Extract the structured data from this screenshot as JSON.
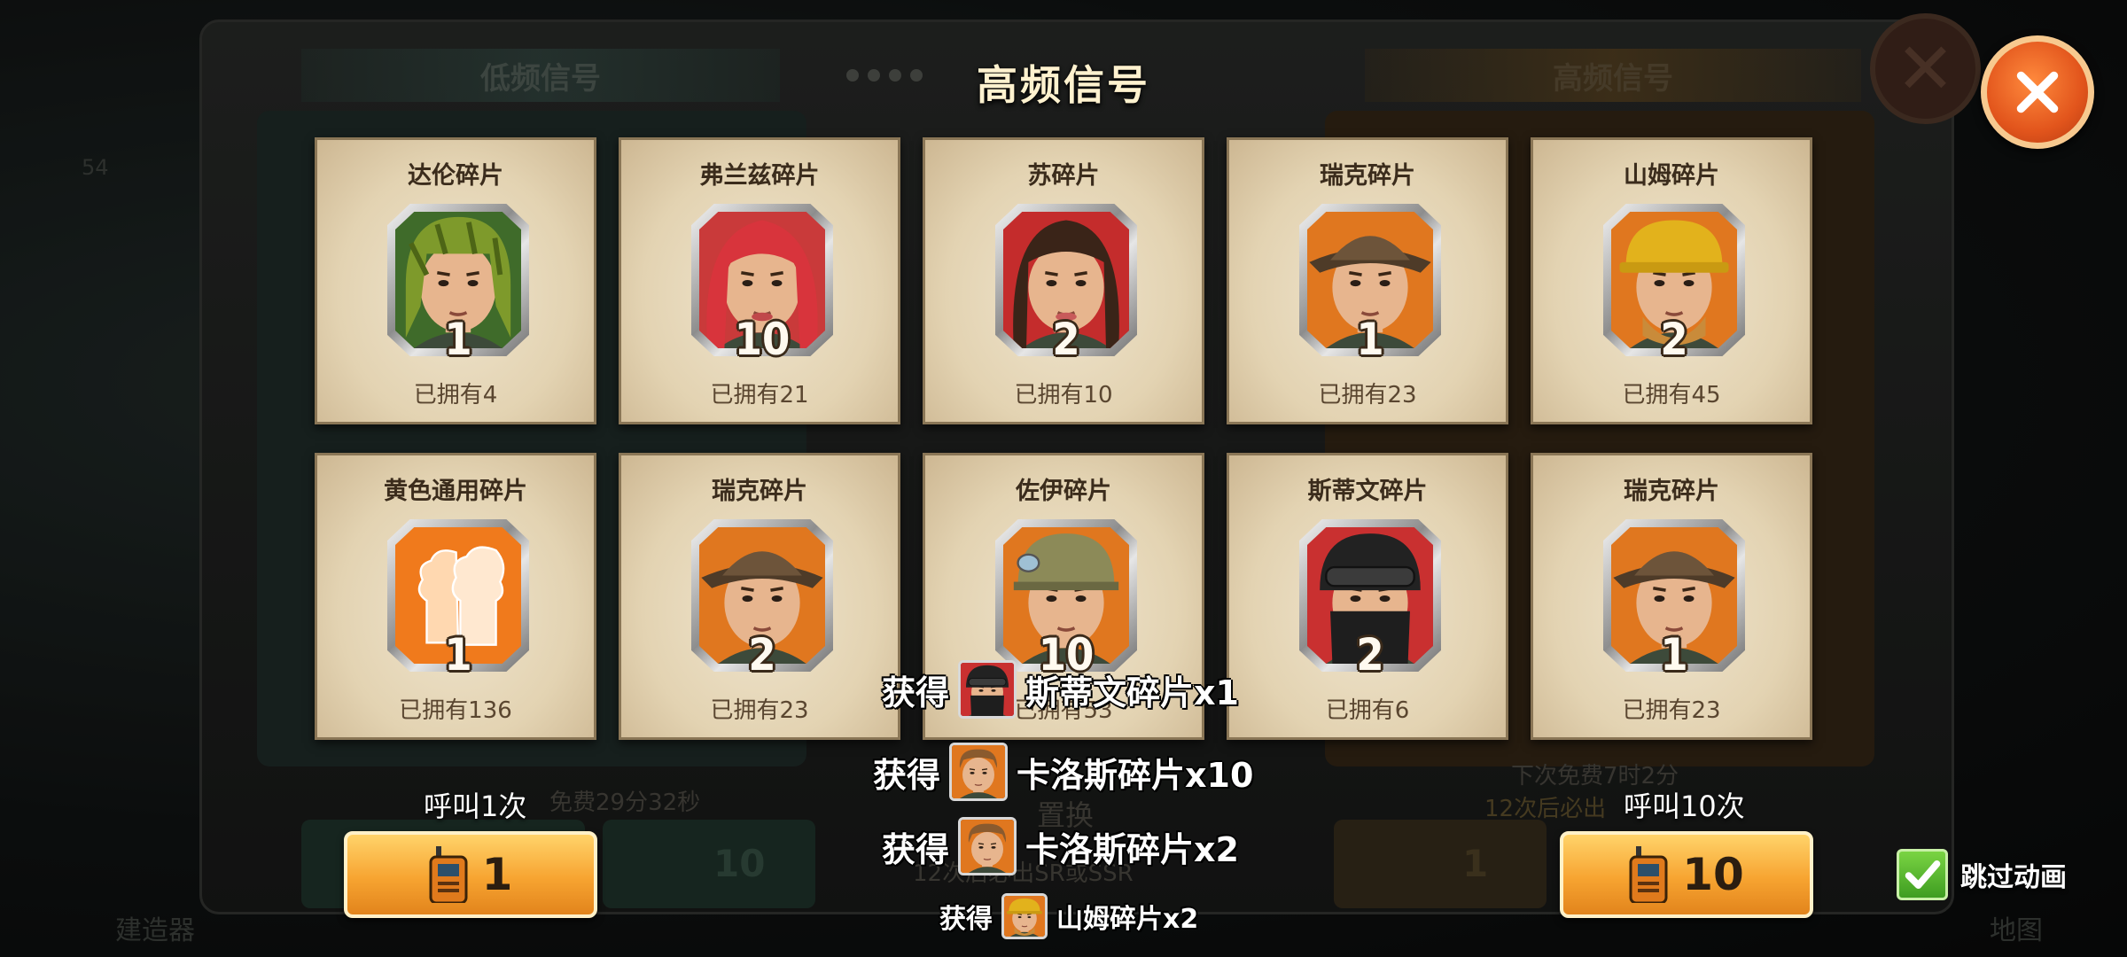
{
  "background": {
    "tab_left": "低频信号",
    "tab_right": "高频信号",
    "left_free_timer": "免费29分32秒",
    "left_bottom_text": "12次后必出SR或SSR",
    "left_btn1_value": "10",
    "right_free_timer": "下次免费7时2分",
    "right_guarantee": "12次后必出",
    "right_btn_left_value": "1",
    "exchange_label": "置换",
    "side_left_label": "建造器",
    "side_right_label": "地图",
    "badge_54": "54"
  },
  "dialog": {
    "title": "高频信号",
    "close_icon": "close-x-icon"
  },
  "cards": [
    {
      "name": "达伦碎片",
      "qty": "1",
      "owned": "已拥有4",
      "portrait": "camo-soldier",
      "bg": "#3f6b2a"
    },
    {
      "name": "弗兰兹碎片",
      "qty": "10",
      "owned": "已拥有21",
      "portrait": "red-hair-girl",
      "bg": "#c93a3a"
    },
    {
      "name": "苏碎片",
      "qty": "2",
      "owned": "已拥有10",
      "portrait": "dark-hair-woman",
      "bg": "#c42c2c"
    },
    {
      "name": "瑞克碎片",
      "qty": "1",
      "owned": "已拥有23",
      "portrait": "hat-man",
      "bg": "#e0771f"
    },
    {
      "name": "山姆碎片",
      "qty": "2",
      "owned": "已拥有45",
      "portrait": "hardhat-man",
      "bg": "#e0771f"
    },
    {
      "name": "黄色通用碎片",
      "qty": "1",
      "owned": "已拥有136",
      "portrait": "universal-fragment",
      "bg": "#f07a1c"
    },
    {
      "name": "瑞克碎片",
      "qty": "2",
      "owned": "已拥有23",
      "portrait": "hat-man",
      "bg": "#e0771f"
    },
    {
      "name": "佐伊碎片",
      "qty": "10",
      "owned": "已拥有53",
      "portrait": "helmet-boy",
      "bg": "#e0771f"
    },
    {
      "name": "斯蒂文碎片",
      "qty": "2",
      "owned": "已拥有6",
      "portrait": "masked-soldier",
      "bg": "#c93030"
    },
    {
      "name": "瑞克碎片",
      "qty": "1",
      "owned": "已拥有23",
      "portrait": "hat-man",
      "bg": "#e0771f"
    }
  ],
  "call_buttons": [
    {
      "label": "呼叫1次",
      "value": "1",
      "icon": "walkie-talkie-icon"
    },
    {
      "label": "呼叫10次",
      "value": "10",
      "icon": "walkie-talkie-icon"
    }
  ],
  "toasts": [
    {
      "prefix": "获得",
      "text": "斯蒂文碎片x1",
      "portrait": "masked-soldier"
    },
    {
      "prefix": "获得",
      "text": "卡洛斯碎片x10",
      "portrait": "young-man"
    },
    {
      "prefix": "获得",
      "text": "卡洛斯碎片x2",
      "portrait": "young-man"
    },
    {
      "prefix": "获得",
      "text": "山姆碎片x2",
      "portrait": "hardhat-man"
    }
  ],
  "skip_animation": {
    "label": "跳过动画",
    "checked": true
  }
}
